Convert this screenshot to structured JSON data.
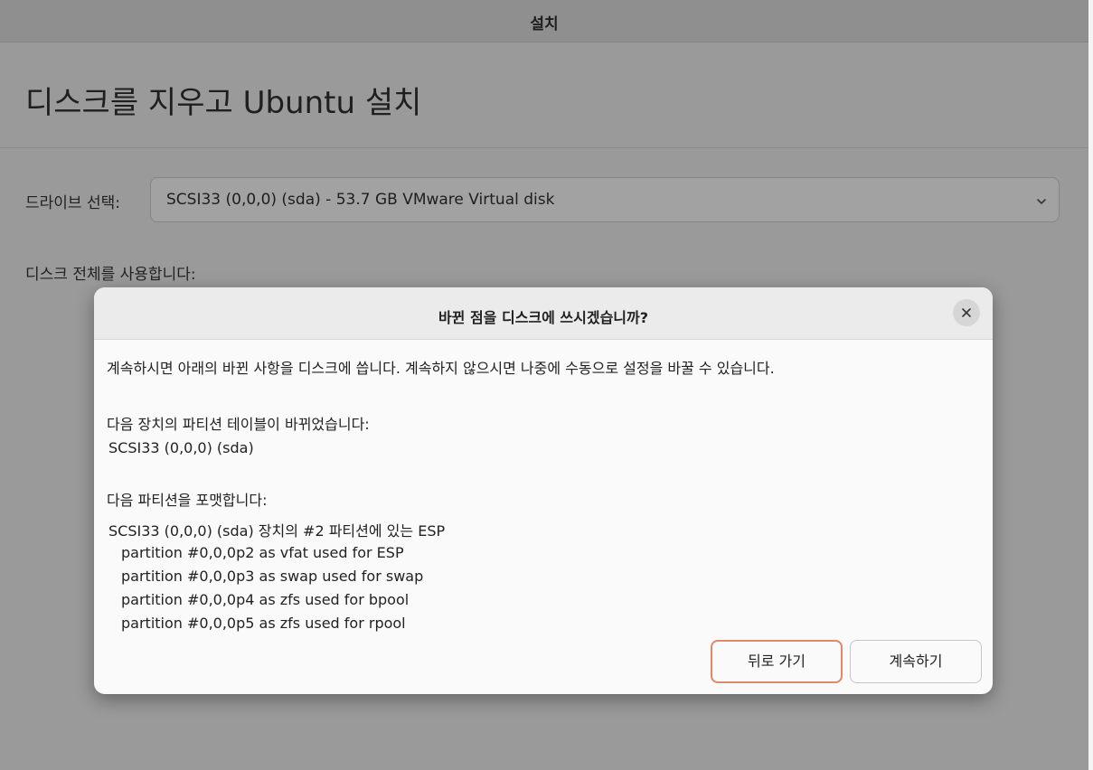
{
  "window": {
    "title": "설치",
    "heading": "디스크를 지우고 Ubuntu 설치",
    "drive_label": "드라이브 선택:",
    "drive_select_value": "SCSI33 (0,0,0) (sda) - 53.7 GB VMware Virtual disk",
    "whole_disk_label": "디스크 전체를 사용합니다:"
  },
  "dialog": {
    "title": "바뀐 점을 디스크에 쓰시겠습니까?",
    "intro": "계속하시면 아래의 바뀐 사항을 디스크에 씁니다. 계속하지 않으시면 나중에 수동으로 설정을 바꿀 수 있습니다.",
    "table_changed_heading": "다음 장치의 파티션 테이블이 바뀌었습니다:",
    "table_changed_device": "SCSI33 (0,0,0) (sda)",
    "format_heading": "다음 파티션을 포맷합니다:",
    "format_device": "SCSI33 (0,0,0) (sda) 장치의 #2 파티션에 있는 ESP",
    "partitions": [
      "partition #0,0,0p2 as vfat used for ESP",
      "partition #0,0,0p3 as swap used for swap",
      "partition #0,0,0p4 as zfs used for bpool",
      "partition #0,0,0p5 as zfs used for rpool"
    ],
    "back_button": "뒤로 가기",
    "continue_button": "계속하기"
  },
  "icons": {
    "close": "close-icon",
    "chevron": "chevron-down-icon"
  },
  "colors": {
    "back_button_border": "#e0886a",
    "dialog_background": "#fafafa",
    "dimmed_window": "#9a9a9a"
  }
}
